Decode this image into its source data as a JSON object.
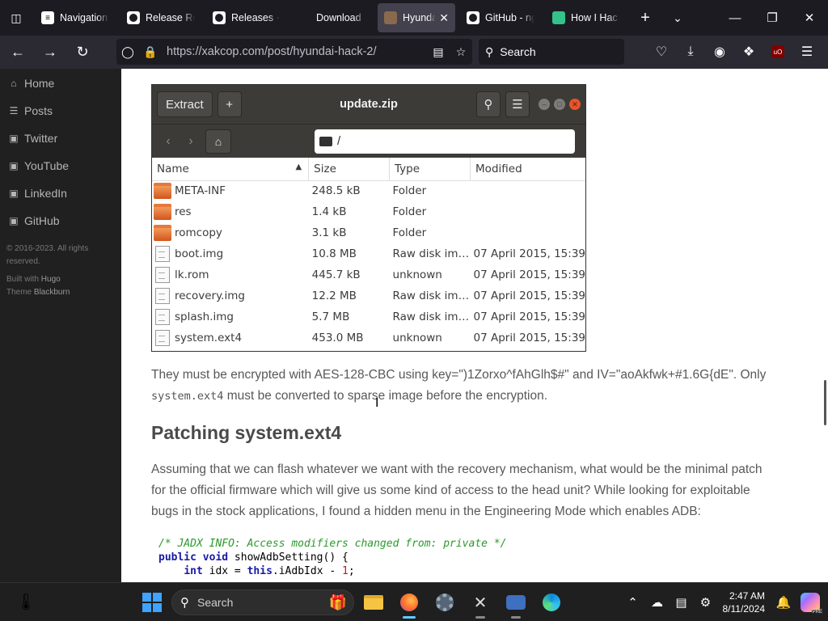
{
  "browser": {
    "tabs": [
      {
        "label": "Navigation",
        "favicon": "nav-icon",
        "active": false
      },
      {
        "label": "Release Ref",
        "favicon": "github-icon",
        "active": false
      },
      {
        "label": "Releases · ",
        "favicon": "github-icon",
        "active": false
      },
      {
        "label": "Download",
        "favicon": "",
        "active": false
      },
      {
        "label": "Hyundai",
        "favicon": "hyundai-icon",
        "active": true
      },
      {
        "label": "GitHub - ng",
        "favicon": "github-icon",
        "active": false
      },
      {
        "label": "How I Hac",
        "favicon": "green-icon",
        "active": false
      }
    ],
    "url": "https://xakcop.com/post/hyundai-hack-2/",
    "search_placeholder": "Search",
    "ublock_badge": "uO"
  },
  "sidebar": {
    "items": [
      {
        "label": "Home",
        "icon": "home-icon"
      },
      {
        "label": "Posts",
        "icon": "list-icon"
      },
      {
        "label": "Twitter",
        "icon": "twitter-icon"
      },
      {
        "label": "YouTube",
        "icon": "youtube-icon"
      },
      {
        "label": "LinkedIn",
        "icon": "linkedin-icon"
      },
      {
        "label": "GitHub",
        "icon": "github-icon"
      }
    ],
    "copyright": "© 2016-2023. All rights reserved.",
    "built_with": "Built with",
    "hugo": "Hugo",
    "theme": "Theme",
    "blackburn": "Blackburn"
  },
  "archive": {
    "extract_label": "Extract",
    "add_label": "+",
    "title": "update.zip",
    "path": "/",
    "columns": [
      "Name",
      "Size",
      "Type",
      "Modified"
    ],
    "rows": [
      {
        "name": "META-INF",
        "size": "248.5 kB",
        "type": "Folder",
        "modified": "",
        "kind": "folder"
      },
      {
        "name": "res",
        "size": "1.4 kB",
        "type": "Folder",
        "modified": "",
        "kind": "folder"
      },
      {
        "name": "romcopy",
        "size": "3.1 kB",
        "type": "Folder",
        "modified": "",
        "kind": "folder"
      },
      {
        "name": "boot.img",
        "size": "10.8 MB",
        "type": "Raw disk im…",
        "modified": "07 April 2015, 15:39",
        "kind": "file"
      },
      {
        "name": "lk.rom",
        "size": "445.7 kB",
        "type": "unknown",
        "modified": "07 April 2015, 15:39",
        "kind": "file"
      },
      {
        "name": "recovery.img",
        "size": "12.2 MB",
        "type": "Raw disk im…",
        "modified": "07 April 2015, 15:39",
        "kind": "file"
      },
      {
        "name": "splash.img",
        "size": "5.7 MB",
        "type": "Raw disk im…",
        "modified": "07 April 2015, 15:39",
        "kind": "file"
      },
      {
        "name": "system.ext4",
        "size": "453.0 MB",
        "type": "unknown",
        "modified": "07 April 2015, 15:39",
        "kind": "file"
      }
    ]
  },
  "article": {
    "para1_text": "They must be encrypted with AES-128-CBC using key=\")1Zorxo^fAhGlh$#\" and IV=\"aoAkfwk+#1.6G{dE\". Only",
    "para1_code": "system.ext4",
    "para1_tail": " must be converted to sparse image before the encryption.",
    "heading": "Patching system.ext4",
    "para2_line1": "Assuming that we can flash whatever we want with the recovery mechanism, what would be the minimal patch",
    "para2_line2": "for the official firmware which will give us some kind of access to the head unit? While looking for exploitable",
    "para2_line3": "bugs in the stock applications, I found a hidden menu in the Engineering Mode which enables ADB:",
    "code_comment": "/* JADX INFO: Access modifiers changed from: private */",
    "code_kw1": "public void",
    "code_line2_rest": " showAdbSetting() {",
    "code_kw_int": "int",
    "code_line3_mid": " idx = ",
    "code_kw_this": "this",
    "code_line3_rest": ".iAdbIdx - ",
    "code_num": "1",
    "code_line3_end": ";"
  },
  "taskbar": {
    "search_placeholder": "Search",
    "time": "2:47 AM",
    "date": "8/11/2024"
  }
}
